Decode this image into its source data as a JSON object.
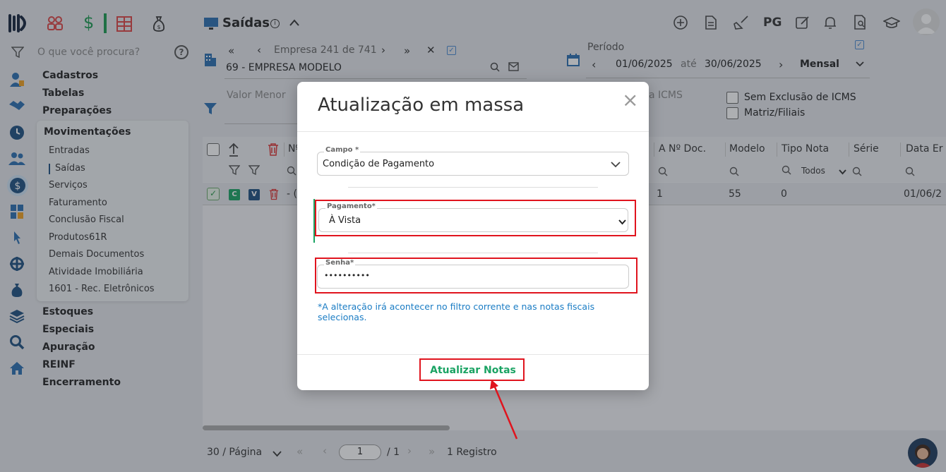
{
  "sidebar": {
    "search_placeholder": "O que você procura?",
    "help_icon": "?",
    "sections": [
      "Cadastros",
      "Tabelas",
      "Preparações"
    ],
    "movimentacoes": {
      "title": "Movimentações",
      "items": [
        "Entradas",
        "Saídas",
        "Serviços",
        "Faturamento",
        "Conclusão Fiscal",
        "Produtos61R",
        "Demais Documentos",
        "Atividade Imobiliária",
        "1601 - Rec. Eletrônicos"
      ]
    },
    "sections_after": [
      "Estoques",
      "Especiais",
      "Apuração",
      "REINF",
      "Encerramento"
    ]
  },
  "header": {
    "title": "Saídas",
    "right_text": "PG"
  },
  "empresa": {
    "nav_text": "Empresa 241 de 741",
    "name": "69 - EMPRESA MODELO"
  },
  "periodo": {
    "label": "Período",
    "from": "01/06/2025",
    "ate": "até",
    "to": "30/06/2025",
    "mode": "Mensal"
  },
  "filters": {
    "valor_menor": "Valor Menor",
    "icms_partial": "a ICMS",
    "sem_exclusao": "Sem Exclusão de ICMS",
    "matriz": "Matriz/Filiais"
  },
  "table": {
    "headers": {
      "col_partial": "Nº",
      "a_doc": "A Nº Doc.",
      "modelo": "Modelo",
      "tipo_nota": "Tipo Nota",
      "serie": "Série",
      "data": "Data Er"
    },
    "tipo_filter": "Todos",
    "row": {
      "badge_c": "C",
      "badge_v": "V",
      "partial": "- (",
      "a_doc": "1",
      "modelo": "55",
      "tipo_nota": "0",
      "data": "01/06/2"
    }
  },
  "pagination": {
    "per_page": "30 / Página",
    "page": "1",
    "of": "/ 1",
    "registros": "1 Registro"
  },
  "modal": {
    "title": "Atualização em massa",
    "close": "×",
    "campo_label": "Campo *",
    "campo_value": "Condição de Pagamento",
    "pagamento_label": "Pagamento*",
    "pagamento_value": "À Vista",
    "senha_label": "Senha*",
    "senha_value": "••••••••••",
    "note": "*A alteração irá acontecer no filtro corrente e nas notas fiscais selecionas.",
    "submit": "Atualizar Notas"
  },
  "colors": {
    "accent_green": "#1aa363",
    "highlight_red": "#e0141e",
    "link_blue": "#1a7cc4",
    "nav_blue": "#1e4f80"
  }
}
